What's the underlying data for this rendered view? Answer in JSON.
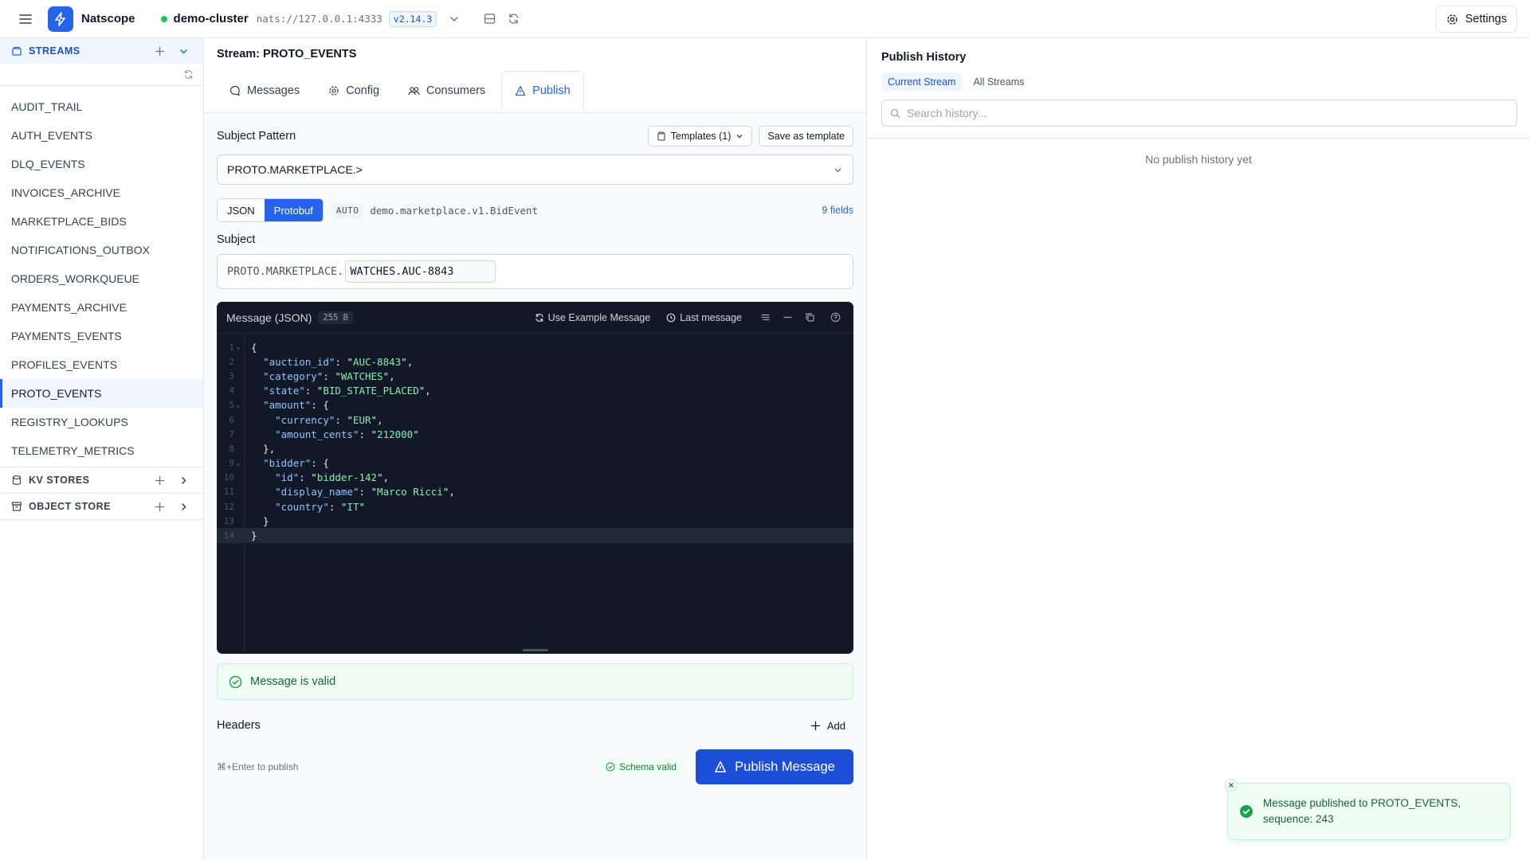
{
  "app": {
    "name": "Natscope"
  },
  "cluster": {
    "name": "demo-cluster",
    "url": "nats://127.0.0.1:4333",
    "version": "v2.14.3",
    "status_color": "#22c55e"
  },
  "topbar": {
    "settings_label": "Settings"
  },
  "sidebar": {
    "streams_label": "STREAMS",
    "kv_label": "KV STORES",
    "object_label": "OBJECT STORE",
    "streams": [
      "AUDIT_TRAIL",
      "AUTH_EVENTS",
      "DLQ_EVENTS",
      "INVOICES_ARCHIVE",
      "MARKETPLACE_BIDS",
      "NOTIFICATIONS_OUTBOX",
      "ORDERS_WORKQUEUE",
      "PAYMENTS_ARCHIVE",
      "PAYMENTS_EVENTS",
      "PROFILES_EVENTS",
      "PROTO_EVENTS",
      "REGISTRY_LOOKUPS",
      "TELEMETRY_METRICS"
    ],
    "active_stream": "PROTO_EVENTS"
  },
  "main": {
    "title": "Stream: PROTO_EVENTS",
    "tabs": [
      {
        "label": "Messages",
        "icon": "message-icon"
      },
      {
        "label": "Config",
        "icon": "gear-icon"
      },
      {
        "label": "Consumers",
        "icon": "users-icon"
      },
      {
        "label": "Publish",
        "icon": "send-icon",
        "active": true
      }
    ],
    "subject_pattern_label": "Subject Pattern",
    "templates_label": "Templates (1)",
    "save_template_label": "Save as template",
    "subject_pattern_value": "PROTO.MARKETPLACE.>",
    "format_json": "JSON",
    "format_protobuf": "Protobuf",
    "auto_badge": "AUTO",
    "proto_type": "demo.marketplace.v1.BidEvent",
    "fields_link": "9 fields",
    "subject_label": "Subject",
    "subject_prefix": "PROTO.MARKETPLACE.",
    "subject_suffix": "WATCHES.AUC-8843",
    "editor": {
      "title": "Message (JSON)",
      "size": "255 B",
      "use_example": "Use Example Message",
      "last_message": "Last message"
    },
    "valid_text": "Message is valid",
    "headers_label": "Headers",
    "add_label": "Add",
    "hint": "⌘+Enter to publish",
    "schema_valid": "Schema valid",
    "publish_label": "Publish Message"
  },
  "message": {
    "auction_id": "AUC-8843",
    "category": "WATCHES",
    "state": "BID_STATE_PLACED",
    "currency": "EUR",
    "amount_cents": "212000",
    "bidder_id": "bidder-142",
    "display_name": "Marco Ricci",
    "country": "IT"
  },
  "history": {
    "title": "Publish History",
    "tab_current": "Current Stream",
    "tab_all": "All Streams",
    "search_placeholder": "Search history...",
    "empty": "No publish history yet"
  },
  "toast": {
    "text": "Message published to PROTO_EVENTS, sequence: 243"
  }
}
